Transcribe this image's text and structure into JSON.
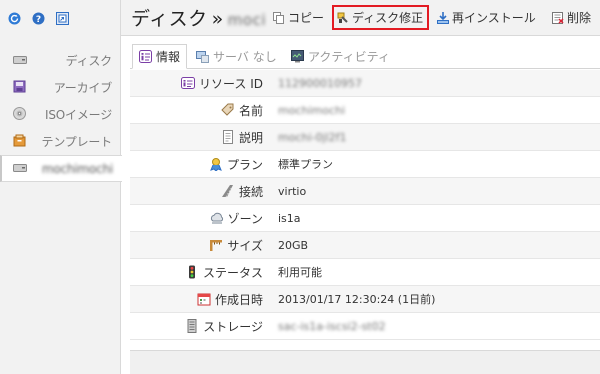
{
  "sidebar": {
    "toolbar": [
      {
        "name": "refresh-icon",
        "color": "#2f7bd6"
      },
      {
        "name": "help-icon",
        "color": "#2f7bd6"
      },
      {
        "name": "window-icon",
        "color": "#2f7bd6"
      }
    ],
    "items": [
      {
        "label": "ディスク",
        "icon": "disk-icon"
      },
      {
        "label": "アーカイブ",
        "icon": "archive-icon"
      },
      {
        "label": "ISOイメージ",
        "icon": "cd-icon"
      },
      {
        "label": "テンプレート",
        "icon": "template-icon"
      },
      {
        "label": "mochimochi",
        "icon": "disk-icon",
        "active": true
      }
    ]
  },
  "header": {
    "title": "ディスク",
    "separator": "»",
    "disk_name": "moci",
    "actions": {
      "copy": "コピー",
      "fix": "ディスク修正",
      "reinstall": "再インストール",
      "delete": "削除"
    },
    "highlight_color": "#e31b23"
  },
  "tabs": [
    {
      "label": "情報",
      "icon": "info-icon",
      "active": true
    },
    {
      "label": "サーバ なし",
      "icon": "server-icon",
      "active": false
    },
    {
      "label": "アクティビティ",
      "icon": "activity-icon",
      "active": false
    }
  ],
  "info": {
    "rows": [
      {
        "key": "リソース ID",
        "icon": "info-icon",
        "value": "112900010957",
        "blurred": true
      },
      {
        "key": "名前",
        "icon": "tag-icon",
        "value": "mochimochi",
        "blurred": true
      },
      {
        "key": "説明",
        "icon": "document-icon",
        "value": "mochi-0jl2f1",
        "blurred": true
      },
      {
        "key": "プラン",
        "icon": "plan-icon",
        "value": "標準プラン",
        "blurred": false
      },
      {
        "key": "接続",
        "icon": "connection-icon",
        "value": "virtio",
        "blurred": false
      },
      {
        "key": "ゾーン",
        "icon": "zone-icon",
        "value": "is1a",
        "blurred": false
      },
      {
        "key": "サイズ",
        "icon": "size-icon",
        "value": "20GB",
        "blurred": false
      },
      {
        "key": "ステータス",
        "icon": "status-icon",
        "value": "利用可能",
        "blurred": false
      },
      {
        "key": "作成日時",
        "icon": "calendar-icon",
        "value": "2013/01/17 12:30:24 (1日前)",
        "blurred": false
      },
      {
        "key": "ストレージ",
        "icon": "storage-icon",
        "value": "sac-is1a-iscsi2-st02",
        "blurred": true
      }
    ]
  }
}
